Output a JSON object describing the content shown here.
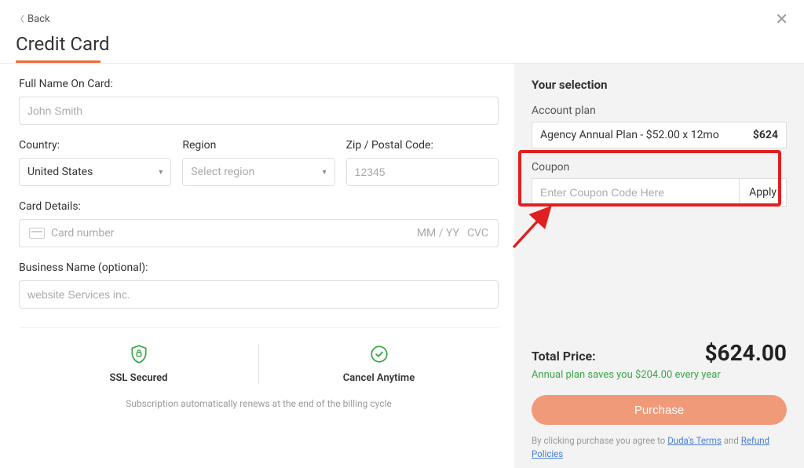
{
  "header": {
    "back_label": "Back",
    "title": "Credit Card"
  },
  "form": {
    "full_name_label": "Full Name On Card:",
    "full_name_placeholder": "John Smith",
    "country_label": "Country:",
    "country_value": "United States",
    "region_label": "Region",
    "region_placeholder": "Select region",
    "zip_label": "Zip / Postal Code:",
    "zip_placeholder": "12345",
    "card_details_label": "Card Details:",
    "card_number_placeholder": "Card number",
    "card_expiry_placeholder": "MM / YY",
    "card_cvc_placeholder": "CVC",
    "business_label": "Business Name (optional):",
    "business_placeholder": "website Services inc."
  },
  "trust": {
    "ssl": "SSL Secured",
    "cancel": "Cancel Anytime",
    "note": "Subscription automatically renews at the end of the billing cycle"
  },
  "summary": {
    "heading": "Your selection",
    "account_plan_label": "Account plan",
    "plan_text": "Agency Annual Plan - $52.00 x 12mo",
    "plan_price": "$624",
    "coupon_label": "Coupon",
    "coupon_placeholder": "Enter Coupon Code Here",
    "apply_label": "Apply",
    "total_label": "Total Price:",
    "total_amount": "$624.00",
    "savings_text": "Annual plan saves you $204.00 every year",
    "purchase_label": "Purchase",
    "agree_prefix": "By clicking purchase you agree to ",
    "terms_link": "Duda's Terms",
    "agree_mid": " and ",
    "refund_link": "Refund Policies"
  }
}
